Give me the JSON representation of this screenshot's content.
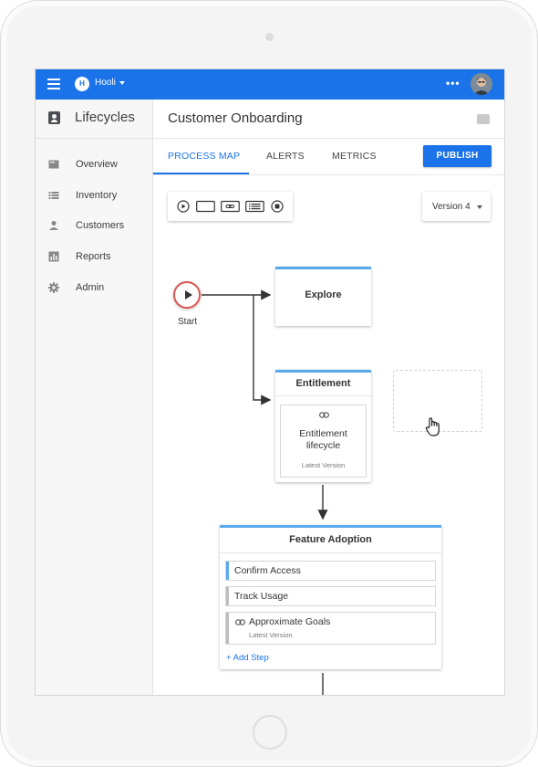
{
  "topbar": {
    "org_initial": "H",
    "org_name": "Hooli",
    "more_label": "•••"
  },
  "sidebar": {
    "title": "Lifecycles",
    "items": [
      {
        "label": "Overview",
        "icon": "overview-icon"
      },
      {
        "label": "Inventory",
        "icon": "list-icon"
      },
      {
        "label": "Customers",
        "icon": "person-icon"
      },
      {
        "label": "Reports",
        "icon": "bar-chart-icon"
      },
      {
        "label": "Admin",
        "icon": "gear-icon"
      }
    ]
  },
  "header": {
    "title": "Customer Onboarding"
  },
  "tabs": [
    {
      "label": "PROCESS MAP",
      "active": true
    },
    {
      "label": "ALERTS",
      "active": false
    },
    {
      "label": "METRICS",
      "active": false
    }
  ],
  "publish_label": "PUBLISH",
  "version": {
    "selected": "Version 4"
  },
  "process_map": {
    "start_label": "Start",
    "explore": {
      "title": "Explore"
    },
    "entitlement": {
      "title": "Entitlement",
      "linked_name": "Entitlement lifecycle",
      "linked_name_line1": "Entitlement",
      "linked_name_line2": "lifecycle",
      "linked_version": "Latest Version"
    },
    "feature_adoption": {
      "title": "Feature Adoption",
      "steps": [
        {
          "label": "Confirm Access",
          "accent": "#5aa9ec"
        },
        {
          "label": "Track Usage",
          "accent": "#bdbdbd"
        },
        {
          "label": "Approximate Goals",
          "sub": "Latest Version",
          "accent": "#bdbdbd",
          "linked": true
        }
      ],
      "add_step_label": "+  Add Step"
    }
  },
  "colors": {
    "primary": "#1a73e8",
    "card_accent": "#5aa9ec",
    "start_ring": "#e05555"
  }
}
